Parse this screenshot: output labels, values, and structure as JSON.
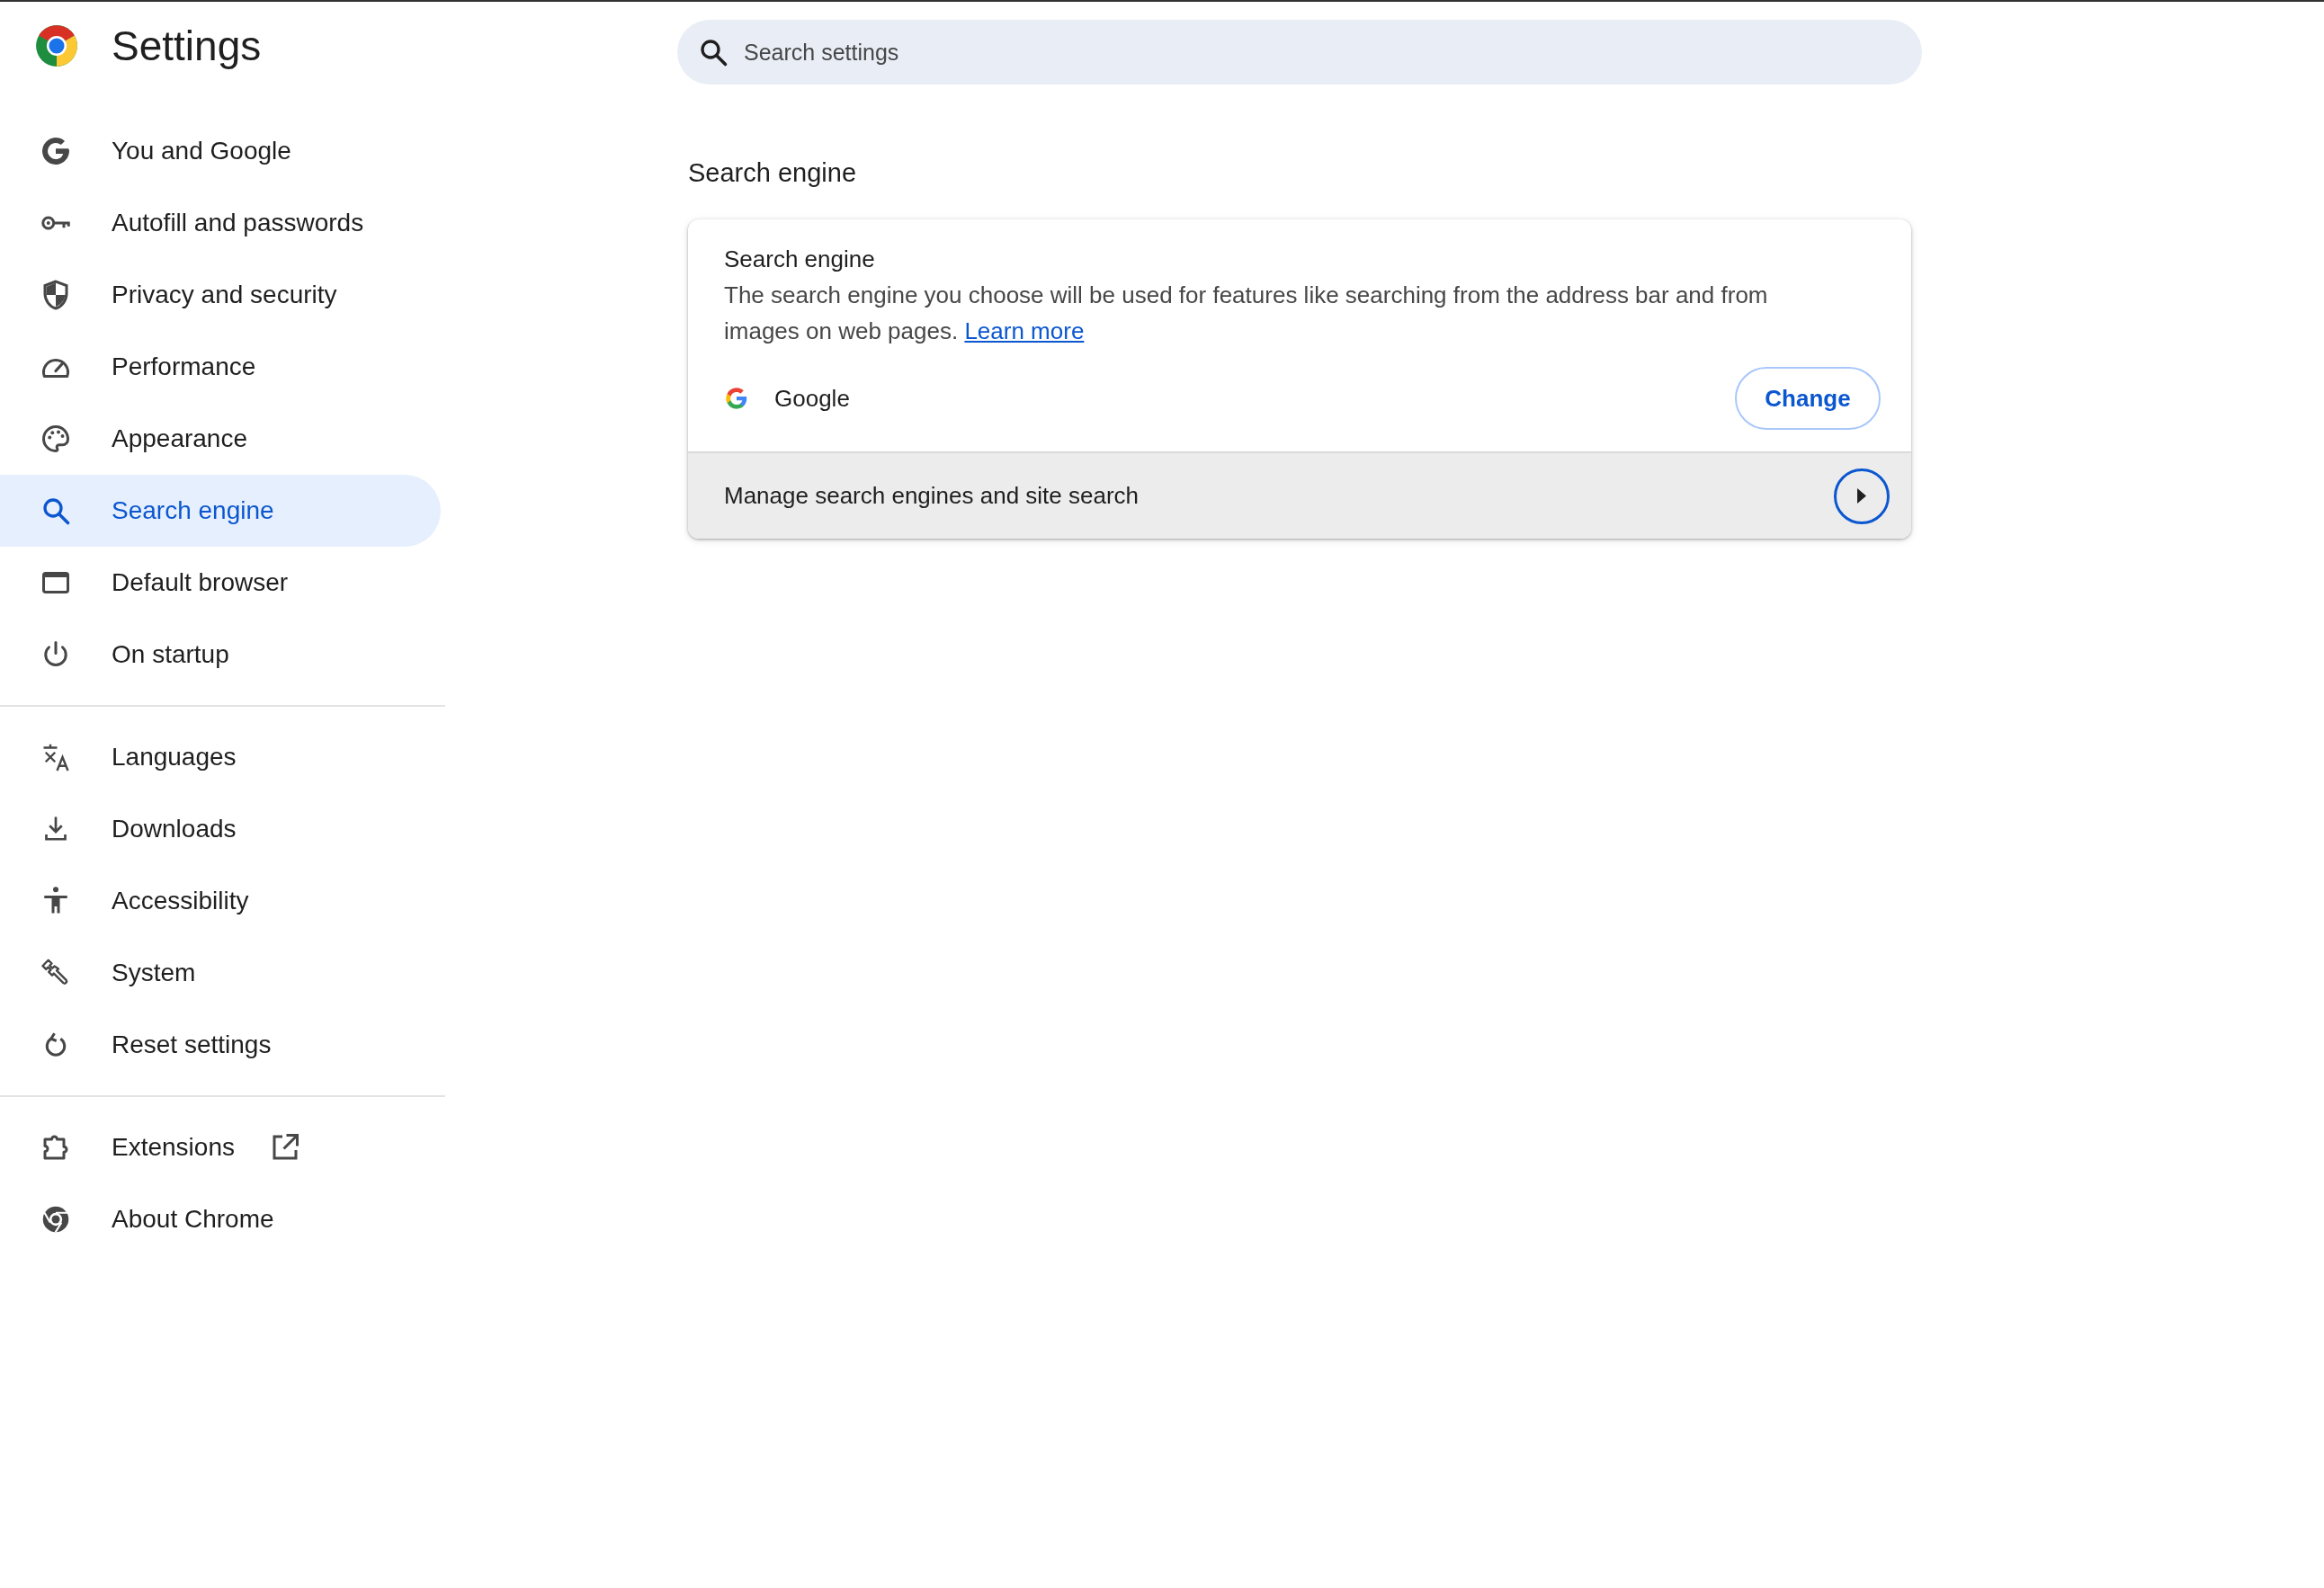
{
  "app": {
    "title": "Settings"
  },
  "sidebar": {
    "groups": [
      {
        "items": [
          {
            "label": "You and Google",
            "selected": false,
            "external": false
          },
          {
            "label": "Autofill and passwords",
            "selected": false,
            "external": false
          },
          {
            "label": "Privacy and security",
            "selected": false,
            "external": false
          },
          {
            "label": "Performance",
            "selected": false,
            "external": false
          },
          {
            "label": "Appearance",
            "selected": false,
            "external": false
          },
          {
            "label": "Search engine",
            "selected": true,
            "external": false
          },
          {
            "label": "Default browser",
            "selected": false,
            "external": false
          },
          {
            "label": "On startup",
            "selected": false,
            "external": false
          }
        ]
      },
      {
        "items": [
          {
            "label": "Languages",
            "selected": false,
            "external": false
          },
          {
            "label": "Downloads",
            "selected": false,
            "external": false
          },
          {
            "label": "Accessibility",
            "selected": false,
            "external": false
          },
          {
            "label": "System",
            "selected": false,
            "external": false
          },
          {
            "label": "Reset settings",
            "selected": false,
            "external": false
          }
        ]
      },
      {
        "items": [
          {
            "label": "Extensions",
            "selected": false,
            "external": true
          },
          {
            "label": "About Chrome",
            "selected": false,
            "external": false
          }
        ]
      }
    ]
  },
  "search": {
    "placeholder": "Search settings"
  },
  "section": {
    "title": "Search engine",
    "card": {
      "title": "Search engine",
      "description": "The search engine you choose will be used for features like searching from the address bar and from images on web pages.",
      "link": "Learn more",
      "engine": "Google",
      "button": "Change",
      "manage_row": "Manage search engines and site search"
    }
  }
}
